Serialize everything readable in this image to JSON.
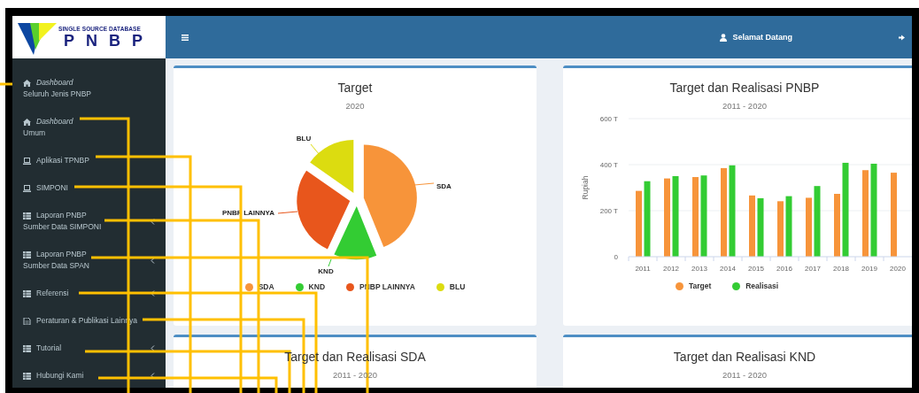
{
  "logo": {
    "tagline": "SINGLE SOURCE DATABASE",
    "name": "PNBP"
  },
  "navbar": {
    "user_label": "Selamat Datang"
  },
  "sidebar": {
    "items": [
      {
        "kind": "home",
        "label": "Dashboard",
        "sublabel": "Seluruh Jenis PNBP",
        "has_submenu": false
      },
      {
        "kind": "home",
        "label": "Dashboard",
        "sublabel": "Umum",
        "has_submenu": false
      },
      {
        "kind": "laptop",
        "label": "Aplikasi TPNBP",
        "has_submenu": false
      },
      {
        "kind": "laptop",
        "label": "SIMPONI",
        "has_submenu": false
      },
      {
        "kind": "table",
        "label": "Laporan PNBP",
        "sublabel": "Sumber Data SIMPONI",
        "has_submenu": true
      },
      {
        "kind": "table",
        "label": "Laporan PNBP",
        "sublabel": "Sumber Data SPAN",
        "has_submenu": true
      },
      {
        "kind": "table",
        "label": "Referensi",
        "has_submenu": true
      },
      {
        "kind": "file",
        "label": "Peraturan & Publikasi Lainnya",
        "has_submenu": false
      },
      {
        "kind": "table",
        "label": "Tutorial",
        "has_submenu": true
      },
      {
        "kind": "table",
        "label": "Hubungi Kami",
        "has_submenu": true
      }
    ]
  },
  "cards": [
    {
      "kind": "pie",
      "title": "Target",
      "subtitle": "2020",
      "pie": {
        "slices": [
          {
            "label": "SDA",
            "color": "#f7943a"
          },
          {
            "label": "KND",
            "color": "#33cc33"
          },
          {
            "label": "PNBP LAINNYA",
            "color": "#e8561c"
          },
          {
            "label": "BLU",
            "color": "#dcdc10"
          }
        ]
      },
      "legend": [
        {
          "label": "SDA",
          "color": "#f7943a"
        },
        {
          "label": "KND",
          "color": "#33cc33"
        },
        {
          "label": "PNBP LAINNYA",
          "color": "#e8561c"
        },
        {
          "label": "BLU",
          "color": "#dcdc10"
        }
      ]
    },
    {
      "kind": "bar",
      "title": "Target dan Realisasi PNBP",
      "subtitle": "2011 - 2020",
      "chart_data": {
        "type": "bar",
        "ylabel": "Rupiah",
        "categories": [
          "2011",
          "2012",
          "2013",
          "2014",
          "2015",
          "2016",
          "2017",
          "2018",
          "2019",
          "2020"
        ],
        "series": [
          {
            "name": "Target",
            "color": "#f7943a",
            "values": [
              286,
              340,
              346,
              385,
              266,
              241,
              256,
              273,
              376,
              365
            ]
          },
          {
            "name": "Realisasi",
            "color": "#33cc33",
            "values": [
              328,
              350,
              353,
              397,
              254,
              263,
              307,
              408,
              404,
              null
            ]
          }
        ],
        "ylim": [
          0,
          600
        ],
        "yticks": [
          {
            "value": 0,
            "label": "0"
          },
          {
            "value": 200,
            "label": "200 T"
          },
          {
            "value": 400,
            "label": "400 T"
          },
          {
            "value": 600,
            "label": "600 T"
          }
        ]
      }
    },
    {
      "kind": "bar",
      "title": "Target dan Realisasi SDA",
      "subtitle": "2011 - 2020"
    },
    {
      "kind": "bar",
      "title": "Target dan Realisasi KND",
      "subtitle": "2011 - 2020"
    }
  ]
}
